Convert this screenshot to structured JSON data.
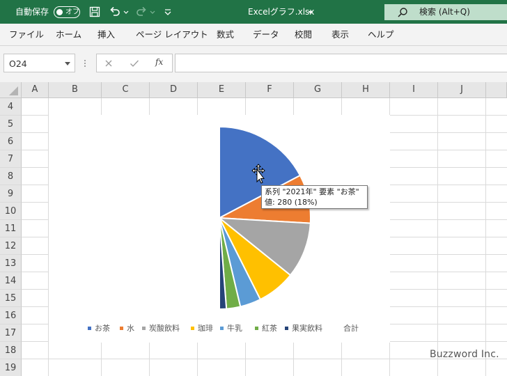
{
  "titlebar": {
    "autosave_label": "自動保存",
    "autosave_state": "オフ",
    "file_name": "Excelグラフ.xlsx",
    "search_text": "検索 (Alt+Q)"
  },
  "menu": [
    "ファイル",
    "ホーム",
    "挿入",
    "ページ レイアウト",
    "数式",
    "データ",
    "校閲",
    "表示",
    "ヘルプ"
  ],
  "formula_bar": {
    "name_box": "O24",
    "fx_label": "fx",
    "formula_value": ""
  },
  "columns": [
    "A",
    "B",
    "C",
    "D",
    "E",
    "F",
    "G",
    "H",
    "I",
    "J"
  ],
  "rows": [
    "4",
    "5",
    "6",
    "7",
    "8",
    "9",
    "10",
    "11",
    "12",
    "13",
    "14",
    "15",
    "16",
    "17",
    "18",
    "19"
  ],
  "chart_data": {
    "type": "pie",
    "series_name": "2021年",
    "categories": [
      "お茶",
      "水",
      "炭酸飲料",
      "珈琲",
      "牛乳",
      "紅茶",
      "果実飲料",
      "合計"
    ],
    "values": [
      280,
      140,
      160,
      110,
      60,
      40,
      20,
      810
    ],
    "colors": [
      "#4472c4",
      "#ed7d31",
      "#a5a5a5",
      "#ffc000",
      "#5b9bd5",
      "#70ad47",
      "#264478",
      "transparent"
    ],
    "legend_position": "bottom"
  },
  "tooltip": {
    "line1": "系列 \"2021年\" 要素 \"お茶\"",
    "line2": "値: 280 (18%)"
  },
  "watermark": "Buzzword Inc."
}
